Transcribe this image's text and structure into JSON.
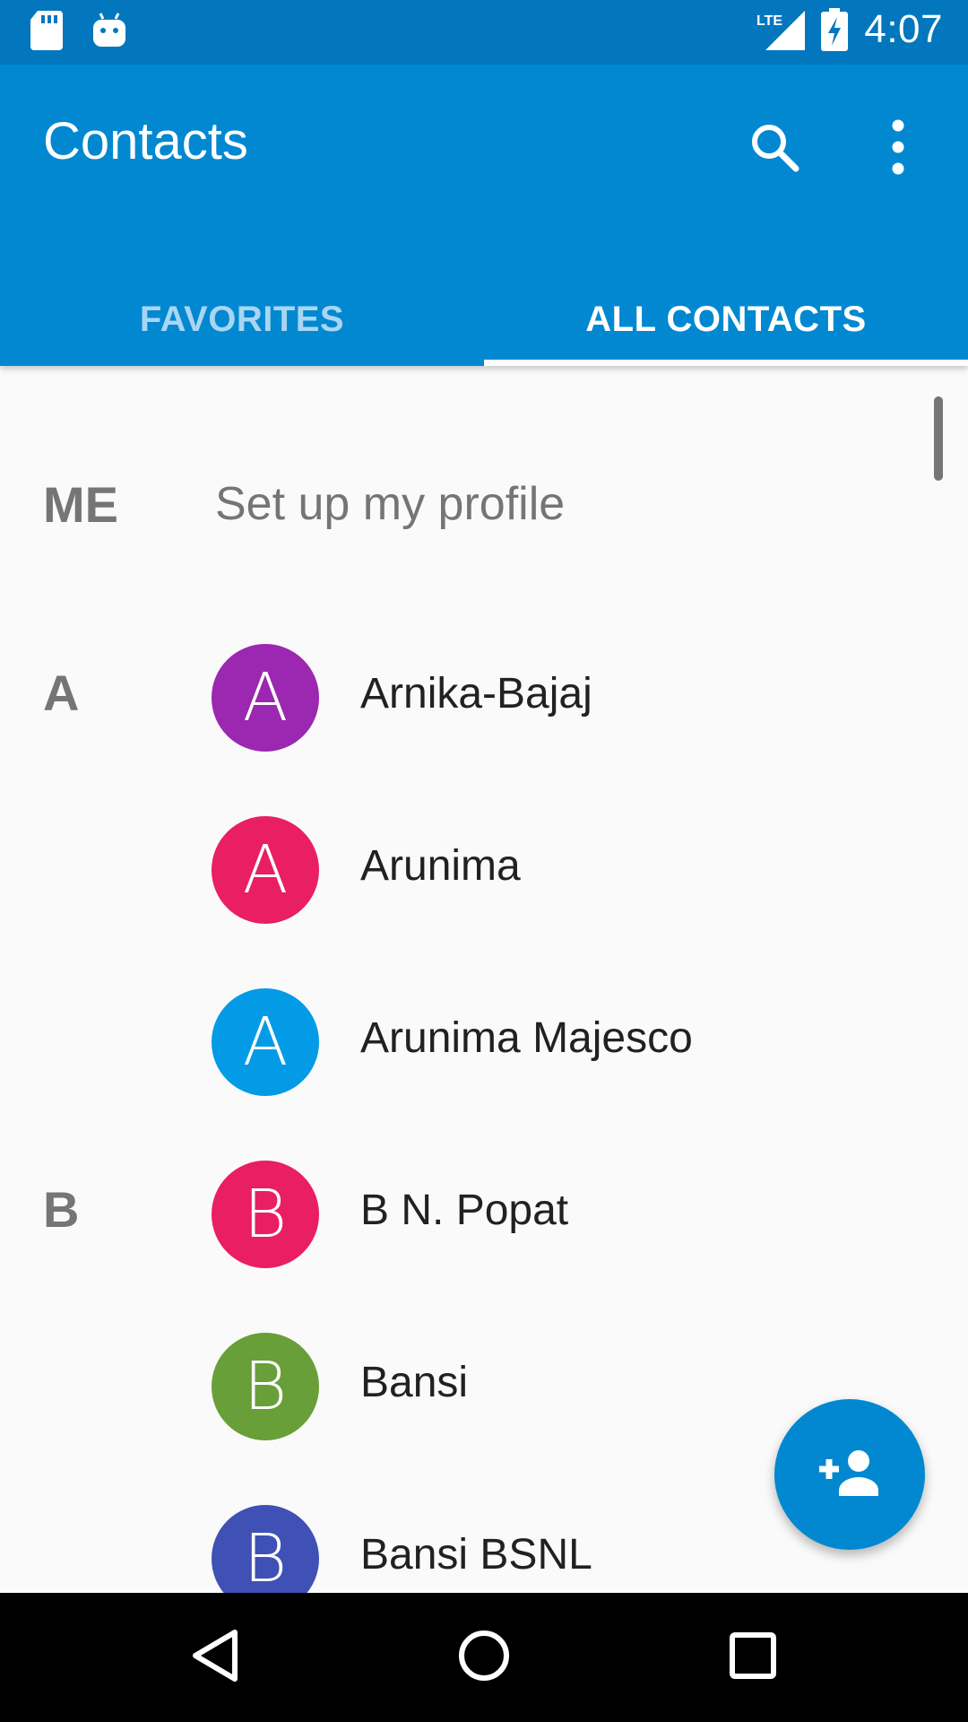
{
  "status_bar": {
    "time": "4:07",
    "left_icons": [
      "sd-card-icon",
      "android-icon"
    ],
    "right_icons": [
      "lte-signal-icon",
      "battery-charging-icon"
    ],
    "network_label": "LTE"
  },
  "app_bar": {
    "title": "Contacts",
    "actions": [
      "search-icon",
      "more-vert-icon"
    ]
  },
  "tabs": [
    {
      "label": "FAVORITES",
      "active": false
    },
    {
      "label": "ALL CONTACTS",
      "active": true
    }
  ],
  "me": {
    "label": "ME",
    "text": "Set up my profile"
  },
  "contacts": [
    {
      "section": "A",
      "initial": "A",
      "name": "Arnika-Bajaj",
      "color": "#9c27b0"
    },
    {
      "section": "",
      "initial": "A",
      "name": "Arunima",
      "color": "#e91e63"
    },
    {
      "section": "",
      "initial": "A",
      "name": "Arunima Majesco",
      "color": "#039be5"
    },
    {
      "section": "B",
      "initial": "B",
      "name": "B N. Popat",
      "color": "#e91e63"
    },
    {
      "section": "",
      "initial": "B",
      "name": "Bansi",
      "color": "#689f38"
    },
    {
      "section": "",
      "initial": "B",
      "name": "Bansi BSNL",
      "color": "#3f51b5"
    }
  ],
  "fab": {
    "icon": "add-person-icon"
  },
  "nav_bar": {
    "buttons": [
      "back-icon",
      "home-icon",
      "recents-icon"
    ]
  },
  "colors": {
    "status_bar": "#0277bd",
    "app_bar": "#0288d1",
    "accent": "#0288d1",
    "list_background": "#fafafa"
  }
}
